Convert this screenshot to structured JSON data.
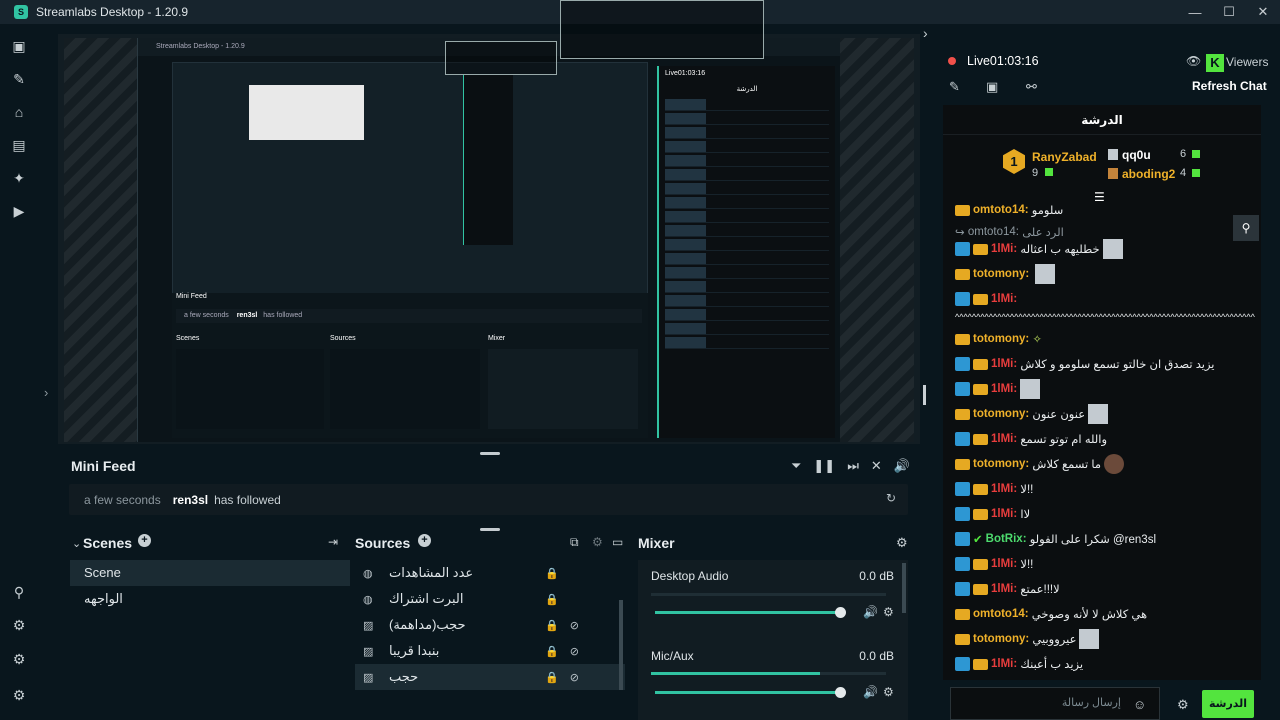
{
  "window": {
    "title": "Streamlabs Desktop - 1.20.9",
    "controls": [
      "minimize",
      "maximize",
      "close"
    ]
  },
  "nav_icons": [
    "studio-icon",
    "themes-icon",
    "store-icon",
    "layout-icon",
    "ai-icon",
    "play-icon",
    "bottom-icon-1",
    "bottom-icon-2",
    "bottom-icon-3",
    "settings-icon"
  ],
  "preview": {
    "inner_title": "Streamlabs Desktop - 1.20.9",
    "mini_feed_label": "Mini Feed",
    "mini_feed_time": "a few seconds",
    "mini_feed_user": "ren3sl",
    "mini_feed_action": "has followed",
    "scenes_label": "Scenes",
    "sources_label": "Sources",
    "mixer_label": "Mixer",
    "chat_title": "الدرشة",
    "live_time": "Live01:03:16"
  },
  "mini_feed": {
    "title": "Mini Feed",
    "time": "a few seconds",
    "user": "ren3sl",
    "action": "has followed"
  },
  "scenes": {
    "title": "Scenes",
    "items": [
      {
        "label": "Scene",
        "active": true
      },
      {
        "label": "الواجهه",
        "active": false
      }
    ]
  },
  "sources": {
    "title": "Sources",
    "items": [
      {
        "label": "عدد المشاهدات",
        "icon": "globe-icon"
      },
      {
        "label": "البرت اشتراك",
        "icon": "globe-icon"
      },
      {
        "label": "حجب(مداهمة)",
        "icon": "image-icon"
      },
      {
        "label": "بنبدا قريبا",
        "icon": "image-icon"
      },
      {
        "label": "حجب",
        "icon": "image-icon"
      }
    ]
  },
  "mixer": {
    "title": "Mixer",
    "channels": [
      {
        "name": "Desktop Audio",
        "db": "0.0 dB",
        "level": 0.0
      },
      {
        "name": "Mic/Aux",
        "db": "0.0 dB",
        "level": 0.72
      }
    ]
  },
  "right_panel": {
    "live_label": "Live01:03:16",
    "viewers_label": "Viewers",
    "refresh_chat": "Refresh Chat"
  },
  "chat": {
    "title": "الدرشة",
    "top_users": [
      {
        "name": "RanyZabad",
        "rank": "1",
        "count": "9"
      },
      {
        "name": "qq0u",
        "count": "6"
      },
      {
        "name": "aboding2",
        "count": "4"
      }
    ],
    "messages": [
      {
        "user": "omtoto14:",
        "text": "سلومو",
        "type": "gold"
      },
      {
        "user": "omtoto14:",
        "text": "الرد على",
        "type": "reply"
      },
      {
        "user": "1lMi:",
        "text": "خطليهه ب اعثاله",
        "type": "red"
      },
      {
        "user": "totomony:",
        "text": "",
        "type": "gold"
      },
      {
        "user": "1lMi:",
        "text": "",
        "type": "red"
      },
      {
        "user": "",
        "text": "^^^^^^^^^^^^^^^^^^^^^^^^^^^^^^^^^^^^^^^^^^^^^^^^^^^^^^^^^^^^^^^^^^^^^^^^^^^^^^^^^^^^^^^^",
        "type": "plain"
      },
      {
        "user": "totomony:",
        "text": "",
        "type": "gold"
      },
      {
        "user": "1lMi:",
        "text": "يزيد تصدق ان خالتو تسمع سلومو و كلاش",
        "type": "red"
      },
      {
        "user": "1lMi:",
        "text": "",
        "type": "red"
      },
      {
        "user": "totomony:",
        "text": "عنون عنون",
        "type": "gold"
      },
      {
        "user": "1lMi:",
        "text": "والله ام توتو تسمع",
        "type": "red"
      },
      {
        "user": "totomony:",
        "text": "ما تسمع كلاش",
        "type": "gold"
      },
      {
        "user": "1lMi:",
        "text": "لا!!",
        "type": "red"
      },
      {
        "user": "1lMi:",
        "text": "لاا",
        "type": "red"
      },
      {
        "user": "BotRix:",
        "text": "شكرا على الفولو @ren3sl",
        "type": "green"
      },
      {
        "user": "1lMi:",
        "text": "لا!!",
        "type": "red"
      },
      {
        "user": "1lMi:",
        "text": "لا!!!عمتع",
        "type": "red"
      },
      {
        "user": "omtoto14:",
        "text": "هي كلاش لا لأنه وصوخي",
        "type": "gold"
      },
      {
        "user": "totomony:",
        "text": "عيرووبيي",
        "type": "gold"
      },
      {
        "user": "1lMi:",
        "text": "يزيد ب أعبنك",
        "type": "red"
      }
    ],
    "input_placeholder": "إرسال رسالة",
    "send_label": "الدرشة"
  }
}
